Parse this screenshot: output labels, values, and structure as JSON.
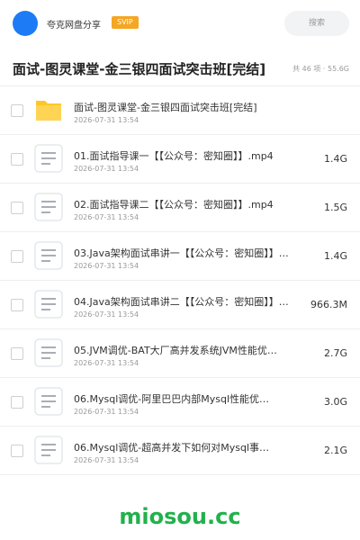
{
  "header": {
    "user_name": "夸克网盘分享",
    "badge": "SVIP",
    "search_placeholder": "搜索",
    "avatar_color": "#1e7bf6",
    "badge_color": "#f5a623"
  },
  "folder": {
    "title": "面试-图灵课堂-金三银四面试突击班[完结]",
    "stats": "共 46 项 · 55.6G"
  },
  "files": [
    {
      "name": "面试-图灵课堂-金三银四面试突击班[完结]",
      "date": "2026-07-31 13:54",
      "size": "",
      "icon": "folder-icon"
    },
    {
      "name": "01.面试指导课一【【公众号：密知圈】】.mp4",
      "date": "2026-07-31 13:54",
      "size": "1.4G",
      "icon": "document-icon"
    },
    {
      "name": "02.面试指导课二【【公众号：密知圈】】.mp4",
      "date": "2026-07-31 13:54",
      "size": "1.5G",
      "icon": "document-icon"
    },
    {
      "name": "03.Java架构面试串讲一【【公众号：密知圈】】…",
      "date": "2026-07-31 13:54",
      "size": "1.4G",
      "icon": "document-icon"
    },
    {
      "name": "04.Java架构面试串讲二【【公众号：密知圈】】…",
      "date": "2026-07-31 13:54",
      "size": "966.3M",
      "icon": "document-icon"
    },
    {
      "name": "05.JVM调优-BAT大厂高并发系统JVM性能优…",
      "date": "2026-07-31 13:54",
      "size": "2.7G",
      "icon": "document-icon"
    },
    {
      "name": "06.Mysql调优-阿里巴巴内部Mysql性能优…",
      "date": "2026-07-31 13:54",
      "size": "3.0G",
      "icon": "document-icon"
    },
    {
      "name": "06.Mysql调优-超高并发下如何对Mysql事…",
      "date": "2026-07-31 13:54",
      "size": "2.1G",
      "icon": "document-icon"
    }
  ],
  "watermark": "miosou.cc",
  "colors": {
    "folder": "#ffc627",
    "watermark": "#22b14c"
  }
}
